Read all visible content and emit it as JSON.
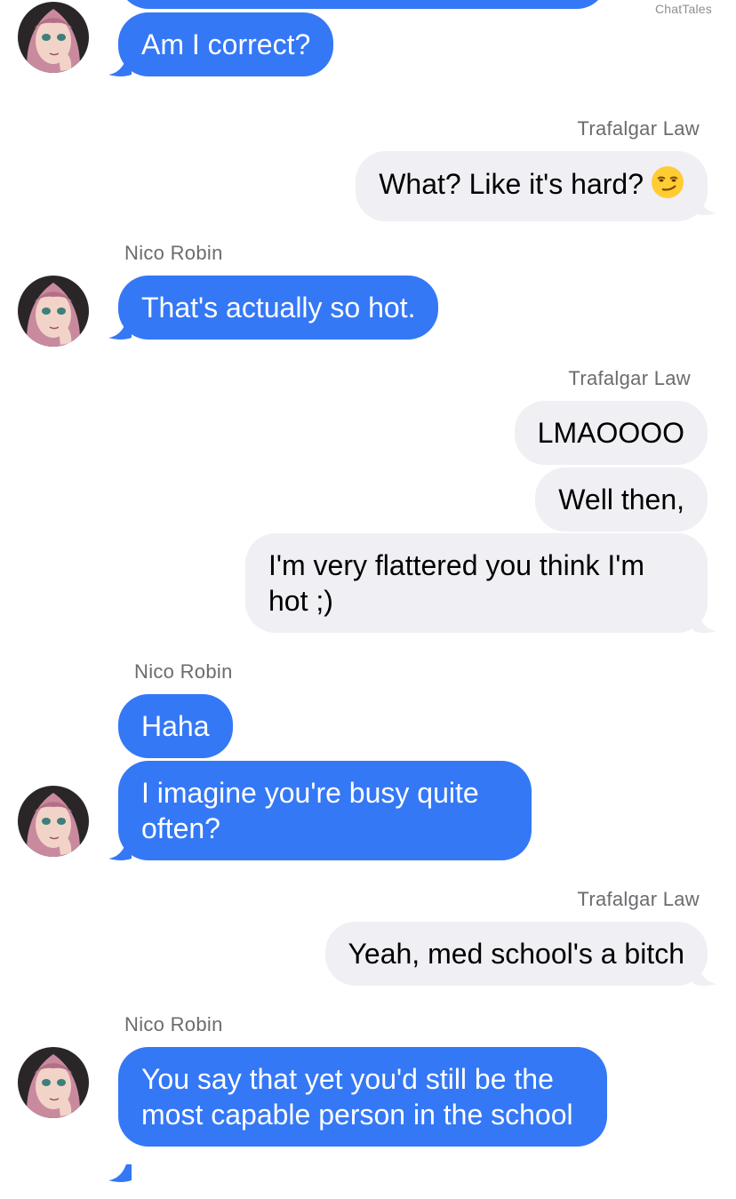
{
  "watermark": "ChatTales",
  "contacts": {
    "them": "Nico Robin",
    "me": "Trafalgar Law"
  },
  "messages": [
    {
      "from": "them",
      "text": "Am I correct?"
    },
    {
      "from": "me",
      "text": "What? Like it's hard?",
      "emoji": "smirking-face"
    },
    {
      "from": "them",
      "text": "That's actually so hot."
    },
    {
      "from": "me",
      "text": "LMAOOOO"
    },
    {
      "from": "me",
      "text": "Well then,"
    },
    {
      "from": "me",
      "text": "I'm very flattered you think I'm hot ;)"
    },
    {
      "from": "them",
      "text": "Haha"
    },
    {
      "from": "them",
      "text": "I imagine you're busy quite often?"
    },
    {
      "from": "me",
      "text": "Yeah, med school's a bitch"
    },
    {
      "from": "them",
      "text": "You say that yet you'd still be the most capable person in the school"
    }
  ],
  "colors": {
    "incoming_bubble": "#3478f6",
    "outgoing_bubble": "#efeff4",
    "avatar_hair": "#c98a9e"
  }
}
